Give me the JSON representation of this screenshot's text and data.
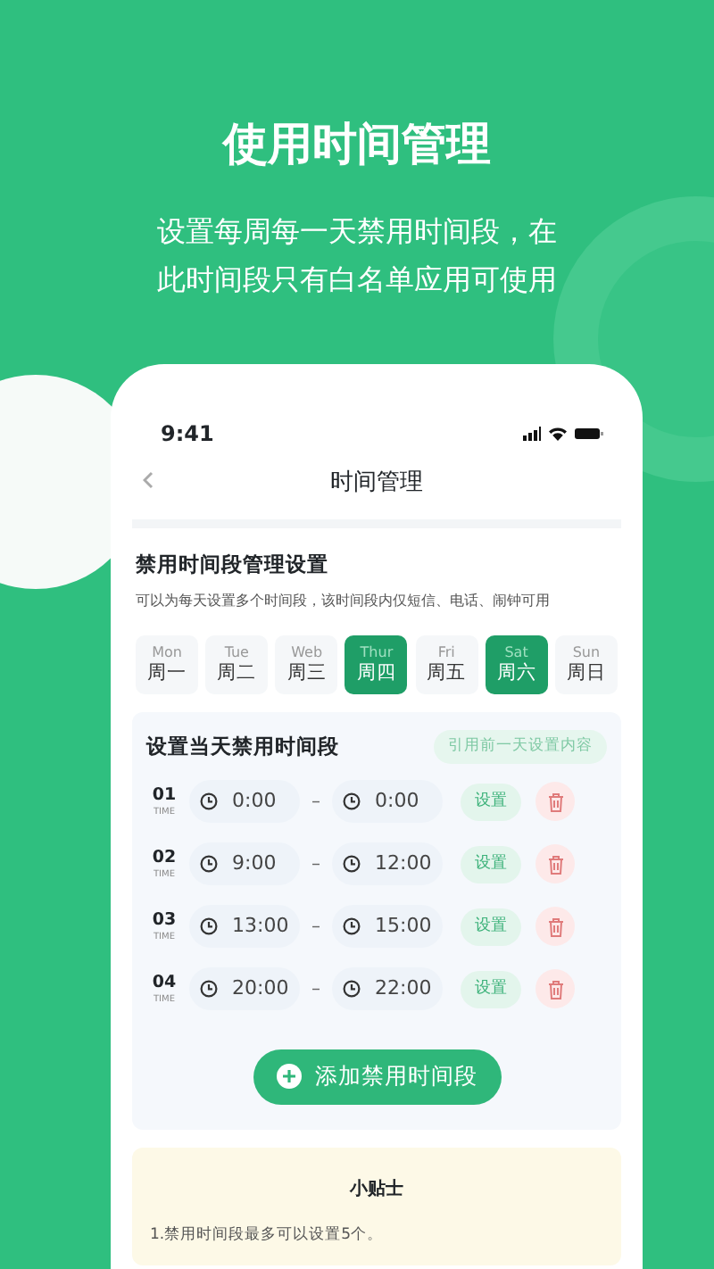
{
  "headline": "使用时间管理",
  "subtitle_lines": [
    "设置每周每一天禁用时间段，在",
    "此时间段只有白名单应用可使用"
  ],
  "phone": {
    "status_time": "9:41",
    "nav_title": "时间管理",
    "section_title": "禁用时间段管理设置",
    "section_description": "可以为每天设置多个时间段，该时间段内仅短信、电话、闹钟可用",
    "days": [
      {
        "en": "Mon",
        "zh": "周一",
        "selected": false
      },
      {
        "en": "Tue",
        "zh": "周二",
        "selected": false
      },
      {
        "en": "Web",
        "zh": "周三",
        "selected": false
      },
      {
        "en": "Thur",
        "zh": "周四",
        "selected": true
      },
      {
        "en": "Fri",
        "zh": "周五",
        "selected": false
      },
      {
        "en": "Sat",
        "zh": "周六",
        "selected": true
      },
      {
        "en": "Sun",
        "zh": "周日",
        "selected": false
      }
    ],
    "card_title": "设置当天禁用时间段",
    "copy_button": "引用前一天设置内容",
    "slots": [
      {
        "number": "01",
        "label": "TIME",
        "start": "0:00",
        "separator": "–",
        "end": "0:00",
        "set_button": "设置"
      },
      {
        "number": "02",
        "label": "TIME",
        "start": "9:00",
        "separator": "–",
        "end": "12:00",
        "set_button": "设置"
      },
      {
        "number": "03",
        "label": "TIME",
        "start": "13:00",
        "separator": "–",
        "end": "15:00",
        "set_button": "设置"
      },
      {
        "number": "04",
        "label": "TIME",
        "start": "20:00",
        "separator": "–",
        "end": "22:00",
        "set_button": "设置"
      }
    ],
    "add_button": "添加禁用时间段",
    "tips_title": "小贴士",
    "tips": [
      "1.禁用时间段最多可以设置5个。"
    ]
  }
}
